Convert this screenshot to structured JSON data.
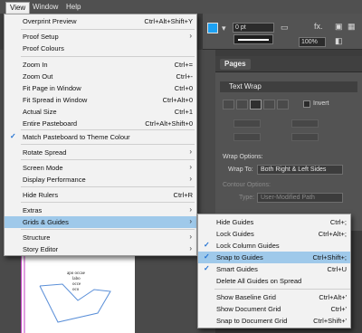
{
  "menubar": {
    "view": "View",
    "window": "Window",
    "help": "Help"
  },
  "control": {
    "stroke_weight": "0 pt",
    "zoom": "100%",
    "fx": "fx."
  },
  "panels": {
    "pages_tab": "Pages",
    "text_wrap": {
      "title": "Text Wrap",
      "invert": "Invert",
      "wrap_options": "Wrap Options:",
      "wrap_to_label": "Wrap To:",
      "wrap_to_value": "Both Right & Left Sides",
      "contour_options": "Contour Options:",
      "type_label": "Type:",
      "type_value": "User-Modified Path"
    }
  },
  "view_menu": [
    {
      "label": "Overprint Preview",
      "shortcut": "Ctrl+Alt+Shift+Y"
    },
    {
      "label": "Proof Setup",
      "submenu": true
    },
    {
      "label": "Proof Colours"
    },
    {
      "label": "Zoom In",
      "shortcut": "Ctrl+="
    },
    {
      "label": "Zoom Out",
      "shortcut": "Ctrl+-"
    },
    {
      "label": "Fit Page in Window",
      "shortcut": "Ctrl+0"
    },
    {
      "label": "Fit Spread in Window",
      "shortcut": "Ctrl+Alt+0"
    },
    {
      "label": "Actual Size",
      "shortcut": "Ctrl+1"
    },
    {
      "label": "Entire Pasteboard",
      "shortcut": "Ctrl+Alt+Shift+0"
    },
    {
      "label": "Match Pasteboard to Theme Colour",
      "checked": true
    },
    {
      "label": "Rotate Spread",
      "submenu": true
    },
    {
      "label": "Screen Mode",
      "submenu": true
    },
    {
      "label": "Display Performance",
      "submenu": true
    },
    {
      "label": "Hide Rulers",
      "shortcut": "Ctrl+R"
    },
    {
      "label": "Extras",
      "submenu": true
    },
    {
      "label": "Grids & Guides",
      "submenu": true,
      "highlighted": true
    },
    {
      "label": "Structure",
      "submenu": true
    },
    {
      "label": "Story Editor",
      "submenu": true
    }
  ],
  "grids_menu": [
    {
      "label": "Hide Guides",
      "shortcut": "Ctrl+;"
    },
    {
      "label": "Lock Guides",
      "shortcut": "Ctrl+Alt+;"
    },
    {
      "label": "Lock Column Guides",
      "checked": true
    },
    {
      "label": "Snap to Guides",
      "shortcut": "Ctrl+Shift+;",
      "checked": true,
      "highlighted": true
    },
    {
      "label": "Smart Guides",
      "shortcut": "Ctrl+U",
      "checked": true
    },
    {
      "label": "Delete All Guides on Spread"
    },
    {
      "label": "Show Baseline Grid",
      "shortcut": "Ctrl+Alt+'"
    },
    {
      "label": "Show Document Grid",
      "shortcut": "Ctrl+'"
    },
    {
      "label": "Snap to Document Grid",
      "shortcut": "Ctrl+Shift+'"
    }
  ],
  "document_text": {
    "line1": "dolorp siiam em",
    "line2": "apo occae",
    "line3": "labo",
    "line4": "occe",
    "line5": "oco"
  },
  "colors": {
    "highlight": "#9fc9ea",
    "check": "#1e6fd2",
    "accent_swatch": "#1da1f2"
  }
}
